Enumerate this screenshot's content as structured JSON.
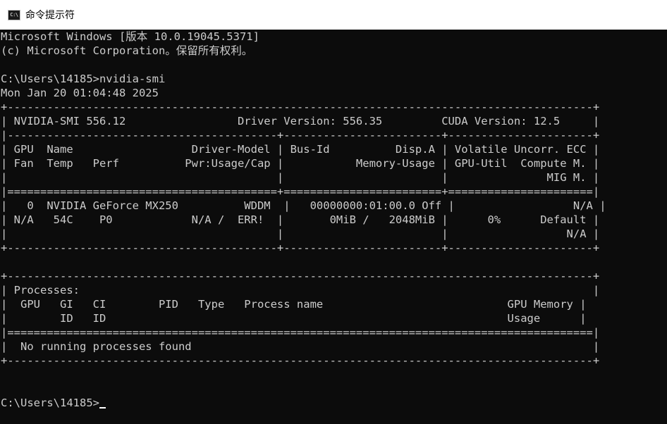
{
  "window": {
    "title": "命令提示符",
    "icon_label": "C:\\"
  },
  "console": {
    "lines": [
      "Microsoft Windows [版本 10.0.19045.5371]",
      "(c) Microsoft Corporation。保留所有权利。",
      "",
      "C:\\Users\\14185>nvidia-smi",
      "Mon Jan 20 01:04:48 2025",
      "+-----------------------------------------------------------------------------------------+",
      "| NVIDIA-SMI 556.12                 Driver Version: 556.35         CUDA Version: 12.5     |",
      "|-----------------------------------------+------------------------+----------------------+",
      "| GPU  Name                  Driver-Model | Bus-Id          Disp.A | Volatile Uncorr. ECC |",
      "| Fan  Temp   Perf          Pwr:Usage/Cap |           Memory-Usage | GPU-Util  Compute M. |",
      "|                                         |                        |               MIG M. |",
      "|=========================================+========================+======================|",
      "|   0  NVIDIA GeForce MX250          WDDM  |   00000000:01:00.0 Off |                  N/A |",
      "| N/A   54C    P0            N/A /  ERR!  |       0MiB /   2048MiB |      0%      Default |",
      "|                                         |                        |                  N/A |",
      "+-----------------------------------------+------------------------+----------------------+",
      "",
      "+-----------------------------------------------------------------------------------------+",
      "| Processes:                                                                              |",
      "|  GPU   GI   CI        PID   Type   Process name                            GPU Memory |",
      "|        ID   ID                                                             Usage      |",
      "|=========================================================================================|",
      "|  No running processes found                                                             |",
      "+-----------------------------------------------------------------------------------------+",
      "",
      ""
    ],
    "prompt": "C:\\Users\\14185>"
  }
}
